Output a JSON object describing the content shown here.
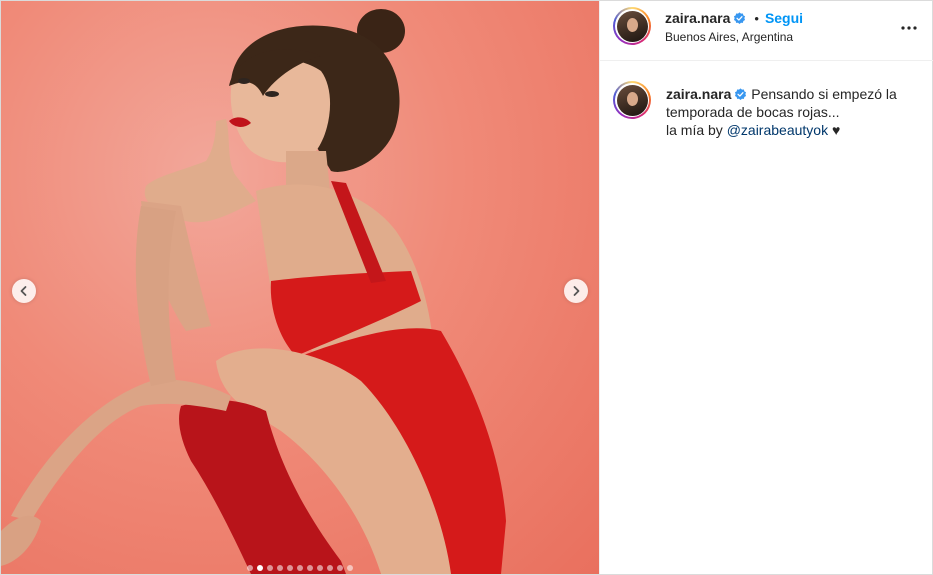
{
  "post": {
    "username": "zaira.nara",
    "follow_label": "Segui",
    "separator": "•",
    "location": "Buenos Aires, Argentina",
    "caption": {
      "username": "zaira.nara",
      "line1": "Pensando si empezó la temporada de bocas rojas...",
      "line2_prefix": "la mía by ",
      "mention": "@zairabeautyok",
      "heart": "♥"
    }
  },
  "carousel": {
    "slide_count": 11,
    "active_index": 1
  },
  "icons": {
    "verified": "verified-badge-icon",
    "more": "more-options-icon",
    "prev": "chevron-left-icon",
    "next": "chevron-right-icon"
  },
  "colors": {
    "link": "#0095f6",
    "mention": "#00376b",
    "verified": "#3897f0",
    "background_photo": "#f08a78",
    "dress": "#d51a1a"
  }
}
